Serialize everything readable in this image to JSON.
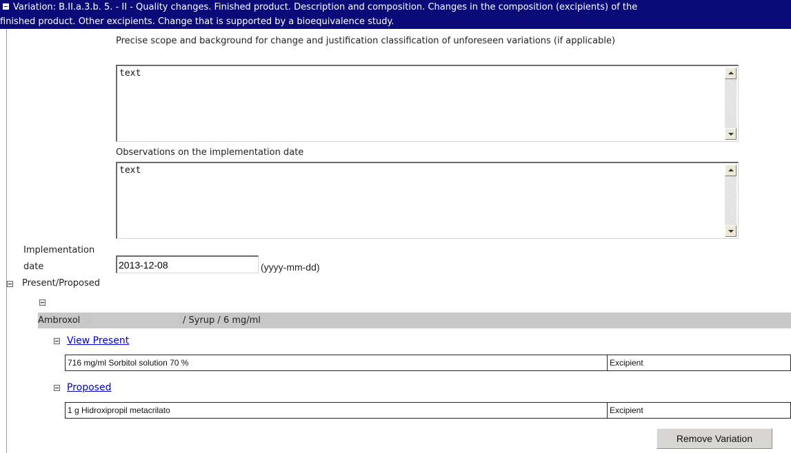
{
  "variation": {
    "title_line1": "Variation: B.II.a.3.b. 5. - II - Quality changes. Finished product. Description and composition. Changes in the composition (excipients) of the",
    "title_line2": "finished product. Other excipients. Change that is supported by a bioequivalence study."
  },
  "scope": {
    "label": "Precise scope and background for change and justification classification of unforeseen variations (if applicable)",
    "value": "text"
  },
  "observations": {
    "label": "Observations on the implementation date",
    "value": "text"
  },
  "implementation": {
    "label_line1": "Implementation",
    "label_line2": "date",
    "value": "2013-12-08",
    "format_hint": "(yyyy-mm-dd)"
  },
  "present_proposed": {
    "label": "Present/Proposed",
    "product_name": "Ambroxol",
    "product_rest": "/ Syrup / 6 mg/ml"
  },
  "present": {
    "link": "View Present",
    "rows": [
      {
        "ingredient": "716 mg/ml Sorbitol solution 70 %",
        "role": "Excipient"
      }
    ]
  },
  "proposed": {
    "link": "Proposed",
    "rows": [
      {
        "ingredient": "1 g Hidroxipropil metacrilato",
        "role": "Excipient"
      }
    ]
  },
  "actions": {
    "remove_label": "Remove Variation"
  },
  "colors": {
    "header_bg": "#0a0a78",
    "product_bar_bg": "#c8c8c8",
    "link": "#0000cc"
  }
}
